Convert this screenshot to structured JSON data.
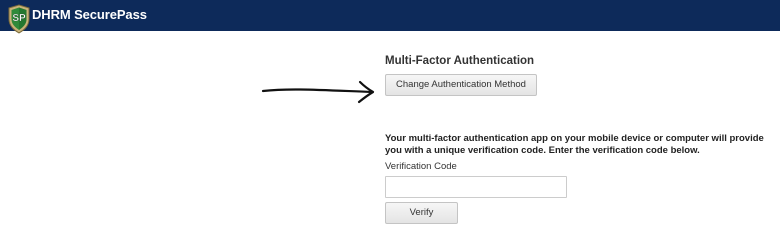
{
  "header": {
    "logo_text": "SP",
    "logo_icon": "shield-icon",
    "title": "DHRM SecurePass",
    "background_color": "#0d2a5a"
  },
  "main": {
    "section_title": "Multi-Factor Authentication",
    "change_method_button": "Change Authentication Method",
    "instructions": "Your multi-factor authentication app on your mobile device or computer will provide you with a unique verification code. Enter the verification code below.",
    "verification": {
      "label": "Verification Code",
      "value": "",
      "placeholder": ""
    },
    "verify_button": "Verify"
  },
  "annotation": {
    "arrow_icon": "hand-drawn-arrow-icon",
    "points_to": "change-authentication-method-button"
  }
}
